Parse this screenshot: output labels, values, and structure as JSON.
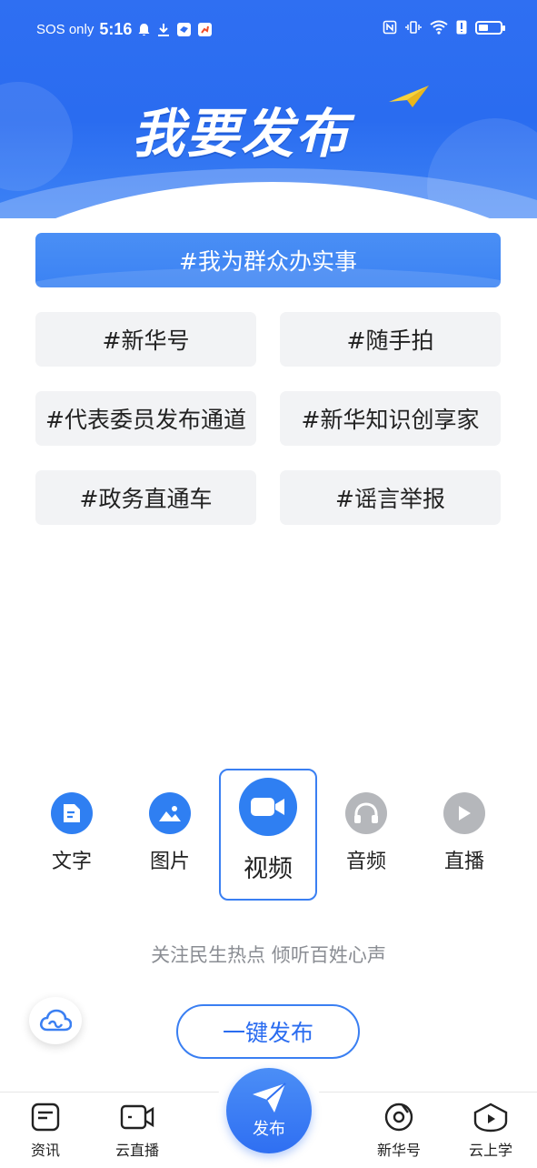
{
  "status_bar": {
    "carrier": "SOS only",
    "time": "5:16"
  },
  "header": {
    "title": "我要发布",
    "accent_color": "#2f6ff2"
  },
  "topics": {
    "main": "#我为群众办实事",
    "items": [
      "#新华号",
      "#随手拍",
      "#代表委员发布通道",
      "#新华知识创享家",
      "#政务直通车",
      "#谣言举报"
    ]
  },
  "publish_types": [
    {
      "label": "文字",
      "icon": "text-doc-icon",
      "color": "#2f7ff2",
      "active": false
    },
    {
      "label": "图片",
      "icon": "image-icon",
      "color": "#2f7ff2",
      "active": false
    },
    {
      "label": "视频",
      "icon": "video-camera-icon",
      "color": "#2f7ff2",
      "active": true
    },
    {
      "label": "音频",
      "icon": "headphones-icon",
      "color": "#b5b7bb",
      "active": false
    },
    {
      "label": "直播",
      "icon": "play-icon",
      "color": "#b5b7bb",
      "active": false
    }
  ],
  "slogan": "关注民生热点 倾听百姓心声",
  "one_click_publish": "一键发布",
  "bottom_nav": {
    "items": [
      {
        "label": "资讯",
        "icon": "news-icon"
      },
      {
        "label": "云直播",
        "icon": "live-camera-icon"
      },
      {
        "label": "发布",
        "icon": "paper-plane-icon"
      },
      {
        "label": "新华号",
        "icon": "disc-icon"
      },
      {
        "label": "云上学",
        "icon": "graduation-play-icon"
      }
    ]
  }
}
